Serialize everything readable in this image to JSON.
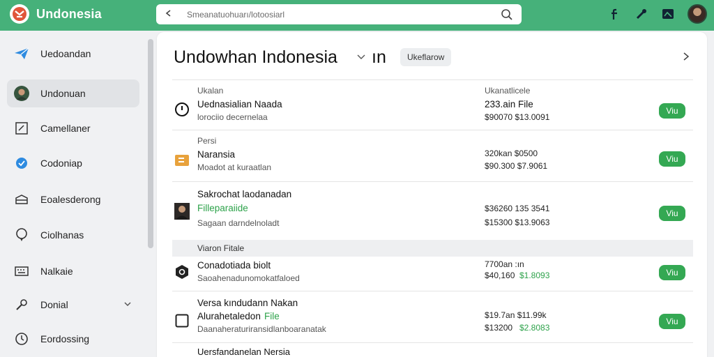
{
  "header": {
    "app_name": "Undonesia",
    "search_placeholder": "Smeanatuohuarı/lotoosiarl"
  },
  "sidebar": {
    "items": [
      {
        "label": "Uedoandan",
        "icon": "paper-plane-icon"
      },
      {
        "label": "Undonuan",
        "icon": "user-avatar-icon"
      },
      {
        "label": "Camellaner",
        "icon": "edit-box-icon"
      },
      {
        "label": "Codoniap",
        "icon": "settings-badge-icon"
      },
      {
        "label": "Eoalesderong",
        "icon": "inbox-tray-icon"
      },
      {
        "label": "Ciolhanas",
        "icon": "chat-bubble-icon"
      },
      {
        "label": "Nalkaie",
        "icon": "keyboard-icon"
      },
      {
        "label": "Donial",
        "icon": "wrench-icon"
      },
      {
        "label": "Eordossing",
        "icon": "clock-icon"
      }
    ]
  },
  "main": {
    "title": "Undowhan Indonesia",
    "title_suffix": "ın",
    "tag": "Ukeflarow",
    "rows": [
      {
        "top_label": "Ukalan",
        "name": "Uednasialian Naada",
        "sub": "lorociio decernelaa",
        "right_top": "Ukanatlicele",
        "right_mid": "233.ain File",
        "right_bot": "$90070  $13.0091",
        "action": "Viu"
      },
      {
        "top_label": "Persi",
        "name": "Naransia",
        "sub": "Moadot at kuraatlan",
        "right_mid": "320kan  $0500",
        "right_bot": "$90.300  $7.9061",
        "action": "Viu"
      },
      {
        "name": "Sakrochat laodanadan",
        "name_green": "Filleparaiide",
        "sub": "Sagaan darndelnoladt",
        "right_mid": "$36260  135 3541",
        "right_bot": "$15300  $13.9063",
        "action": "Viu"
      },
      {
        "name": "Conadotiada biolt",
        "sub": "Saoahenadunomokatfaloed",
        "right_mid": "7700an  :ın",
        "right_bot": "$40,160",
        "right_bot_green": "$1.8093",
        "action": "Viu"
      },
      {
        "top_name": "Versa kındudann Nakan",
        "name": "Alurahetaledon",
        "name_green_suffix": "File",
        "sub": "Daanaheraturiransidlanboaranatak",
        "right_mid": "$19.7an  $11.99k",
        "right_bot": "$13200",
        "right_bot_green": "$2.8083",
        "action": "Viu"
      }
    ],
    "section_label": "Viaron Fitale",
    "footer_row": "Uersfandanelan Nersia"
  }
}
